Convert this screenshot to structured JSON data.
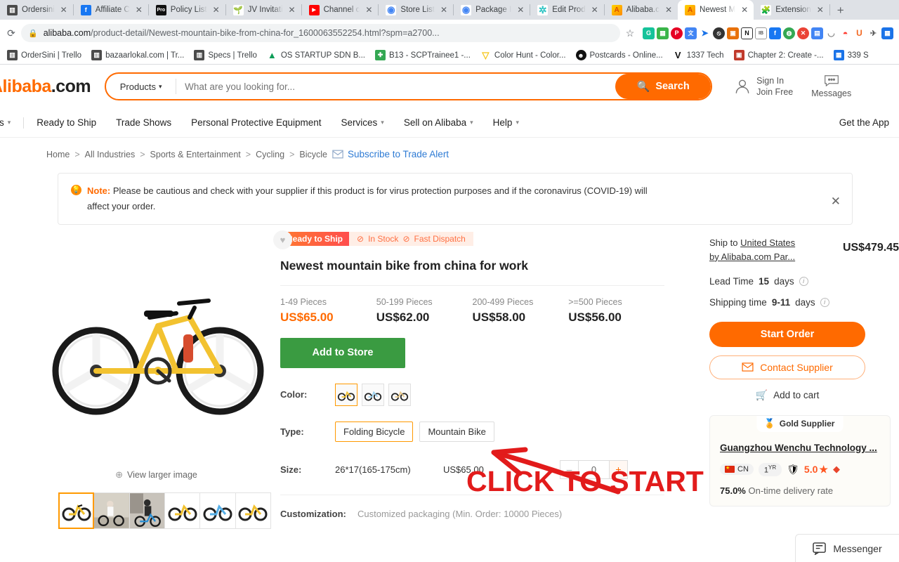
{
  "browser": {
    "tabs": [
      {
        "label": "Ordersini",
        "icon": "trello-icon",
        "color": "#4b4b4b",
        "glyph": "▥",
        "active": false
      },
      {
        "label": "Affiliate C",
        "icon": "facebook-icon",
        "color": "#1877f2",
        "glyph": "f",
        "active": false
      },
      {
        "label": "Policy List",
        "icon": "pro-icon",
        "color": "#111111",
        "glyph": "Pro",
        "active": false
      },
      {
        "label": "JV Invitati",
        "icon": "leaf-icon",
        "color": "#ffffff",
        "glyph": "🌱",
        "active": false
      },
      {
        "label": "Channel c",
        "icon": "youtube-icon",
        "color": "#ff0000",
        "glyph": "▶",
        "active": false
      },
      {
        "label": "Store List",
        "icon": "chrome-icon",
        "color": "#ffffff",
        "glyph": "◉",
        "active": false
      },
      {
        "label": "Package I",
        "icon": "chrome-icon",
        "color": "#ffffff",
        "glyph": "◉",
        "active": false
      },
      {
        "label": "Edit Prod",
        "icon": "puzzle-teal-icon",
        "color": "#ffffff",
        "glyph": "✲",
        "active": false
      },
      {
        "label": "Alibaba.c",
        "icon": "alibaba-icon",
        "color": "#ffd400",
        "glyph": "A",
        "active": false
      },
      {
        "label": "Newest M",
        "icon": "alibaba-icon",
        "color": "#ffd400",
        "glyph": "A",
        "active": true
      },
      {
        "label": "Extension",
        "icon": "puzzle-icon",
        "color": "#ffffff",
        "glyph": "🧩",
        "active": false
      }
    ],
    "new_tab_label": "+",
    "address": {
      "lock_icon": "lock-icon",
      "domain": "alibaba.com",
      "path": "/product-detail/Newest-mountain-bike-from-china-for_1600063552254.html?spm=a2700...",
      "star_icon": "bookmark-star-icon"
    },
    "extensions": [
      {
        "name": "grammarly-extension",
        "glyph": "G",
        "color": "#15c39a"
      },
      {
        "name": "green-ext",
        "glyph": "▦",
        "color": "#3ab54a"
      },
      {
        "name": "pinterest-ext",
        "glyph": "P",
        "color": "#e60023"
      },
      {
        "name": "translate-ext",
        "glyph": "文",
        "color": "#4285f4"
      },
      {
        "name": "send-ext",
        "glyph": "➤",
        "color": "#1a73e8"
      },
      {
        "name": "block-ext",
        "glyph": "⦸",
        "color": "#333333"
      },
      {
        "name": "picture-ext",
        "glyph": "▣",
        "color": "#e8710a"
      },
      {
        "name": "notion-ext",
        "glyph": "N",
        "color": "#111111"
      },
      {
        "name": "ib-ext",
        "glyph": "IB",
        "color": "#555555"
      },
      {
        "name": "facebook-ext",
        "glyph": "f",
        "color": "#1877f2"
      },
      {
        "name": "globe-ext",
        "glyph": "◍",
        "color": "#34a853"
      },
      {
        "name": "close-ext",
        "glyph": "✕",
        "color": "#ea4335"
      },
      {
        "name": "blue-ext",
        "glyph": "▤",
        "color": "#4285f4"
      },
      {
        "name": "smile-ext",
        "glyph": "◡",
        "color": "#888888"
      },
      {
        "name": "magnet-ext",
        "glyph": "U",
        "color": "#ff3b30"
      },
      {
        "name": "honey-ext",
        "glyph": "U",
        "color": "#f26822"
      },
      {
        "name": "bird-ext",
        "glyph": "✈",
        "color": "#5a5a5a"
      },
      {
        "name": "grid-ext",
        "glyph": "▦",
        "color": "#1a73e8"
      }
    ],
    "bookmarks": [
      {
        "label": "OrderSini | Trello",
        "glyph": "▥",
        "color": "#4b4b4b"
      },
      {
        "label": "bazaarlokal.com | Tr...",
        "glyph": "▥",
        "color": "#4b4b4b"
      },
      {
        "label": "Specs | Trello",
        "glyph": "▥",
        "color": "#4b4b4b"
      },
      {
        "label": "OS STARTUP SDN B...",
        "glyph": "▲",
        "color": "#0f9d58"
      },
      {
        "label": "B13 - SCPTrainee1 -...",
        "glyph": "✚",
        "color": "#34a853"
      },
      {
        "label": "Color Hunt - Color...",
        "glyph": "▽",
        "color": "#f5c518"
      },
      {
        "label": "Postcards - Online...",
        "glyph": "☻",
        "color": "#111111"
      },
      {
        "label": "1337 Tech",
        "glyph": "V",
        "color": "#111111"
      },
      {
        "label": "Chapter 2: Create -...",
        "glyph": "▣",
        "color": "#c0392b"
      },
      {
        "label": "339 S",
        "glyph": "▦",
        "color": "#1a73e8"
      }
    ]
  },
  "site": {
    "logo_main": "Alibaba",
    "logo_suffix": ".com",
    "search": {
      "category": "Products",
      "chevron_icon": "chevron-down-icon",
      "placeholder": "What are you looking for...",
      "value": "",
      "button_label": "Search",
      "search_icon": "search-icon"
    },
    "account": {
      "user_icon": "user-icon",
      "sign_in": "Sign In",
      "join_free": "Join Free",
      "messages_icon": "messages-icon",
      "messages_label": "Messages"
    },
    "nav": [
      {
        "label": "ries",
        "has_chevron": true
      },
      {
        "label": "Ready to Ship",
        "has_chevron": false
      },
      {
        "label": "Trade Shows",
        "has_chevron": false
      },
      {
        "label": "Personal Protective Equipment",
        "has_chevron": false
      },
      {
        "label": "Services",
        "has_chevron": true
      },
      {
        "label": "Sell on Alibaba",
        "has_chevron": true
      },
      {
        "label": "Help",
        "has_chevron": true
      }
    ],
    "get_the_app": "Get the App"
  },
  "breadcrumb": {
    "items": [
      "Home",
      "All Industries",
      "Sports & Entertainment",
      "Cycling",
      "Bicycle"
    ],
    "separator": ">",
    "trade_alert": "Subscribe to Trade Alert",
    "envelope_icon": "envelope-icon"
  },
  "note": {
    "bulb_icon": "lightbulb-icon",
    "prefix": "Note:",
    "text": "Please be cautious and check with your supplier if this product is for virus protection purposes and if the coronavirus (COVID-19) will affect your order.",
    "close_icon": "close-icon"
  },
  "gallery": {
    "heart_icon": "heart-icon",
    "view_larger": "View larger image",
    "zoom_icon": "zoom-in-icon",
    "thumbs": [
      {
        "name": "thumb-yellow-bike",
        "selected": true
      },
      {
        "name": "thumb-woman-riding",
        "selected": false
      },
      {
        "name": "thumb-man-blue-bike",
        "selected": false
      },
      {
        "name": "thumb-yellow-bike-2",
        "selected": false
      },
      {
        "name": "thumb-blue-bike",
        "selected": false
      },
      {
        "name": "thumb-yellow-bike-3",
        "selected": false
      }
    ]
  },
  "product": {
    "badge_ready": "Ready to Ship",
    "badge_in_stock": "In Stock",
    "badge_fast_dispatch": "Fast Dispatch",
    "check_icon": "check-circle-icon",
    "title": "Newest mountain bike from china for work",
    "tiers": [
      {
        "qty": "1-49 Pieces",
        "price": "US$65.00"
      },
      {
        "qty": "50-199 Pieces",
        "price": "US$62.00"
      },
      {
        "qty": "200-499 Pieces",
        "price": "US$58.00"
      },
      {
        "qty": ">=500 Pieces",
        "price": "US$56.00"
      }
    ],
    "add_to_store": "Add to Store",
    "options": {
      "color_label": "Color:",
      "colors": [
        {
          "name": "color-yellow-bike",
          "selected": true
        },
        {
          "name": "color-white-bike",
          "selected": false
        },
        {
          "name": "color-cream-bike",
          "selected": false
        }
      ],
      "type_label": "Type:",
      "types": [
        {
          "label": "Folding Bicycle",
          "selected": true
        },
        {
          "label": "Mountain Bike",
          "selected": false
        }
      ],
      "size_label": "Size:",
      "size_name": "26*17(165-175cm)",
      "size_price": "US$65.00",
      "qty_value": "0",
      "minus": "–",
      "plus": "+"
    },
    "customization_label": "Customization:",
    "customization_value": "Customized packaging",
    "customization_note": "(Min. Order: 10000 Pieces)"
  },
  "buybox": {
    "ship_to_prefix": "Ship to ",
    "ship_to_country": "United States",
    "ship_by": "by Alibaba.com Par...",
    "ship_price": "US$479.45",
    "lead_time_label": "Lead Time",
    "lead_time_value": "15",
    "lead_time_unit": "days",
    "shipping_time_label": "Shipping time",
    "shipping_time_value": "9-11",
    "shipping_time_unit": "days",
    "start_order": "Start Order",
    "contact_supplier": "Contact Supplier",
    "envelope_icon": "envelope-icon",
    "add_to_cart": "Add to cart",
    "cart_icon": "cart-icon",
    "info_icon": "info-icon"
  },
  "supplier": {
    "gold_label": "Gold Supplier",
    "gold_icon": "gold-medal-icon",
    "name": "Guangzhou Wenchu Technology ...",
    "country_code": "CN",
    "flag_icon": "flag-cn-icon",
    "years": "1",
    "years_sup": "YR",
    "shield_icon": "shield-gold-icon",
    "rating": "5.0",
    "star_icon": "star-icon",
    "diamond_icon": "diamond-icon",
    "ontime_value": "75.0%",
    "ontime_label": "On-time delivery rate"
  },
  "annotation": {
    "text": "CLICK TO START",
    "color": "#e21b1b",
    "arrow_icon": "arrow-left-annotation"
  },
  "messenger": {
    "label": "Messenger",
    "icon": "messenger-chat-icon"
  }
}
